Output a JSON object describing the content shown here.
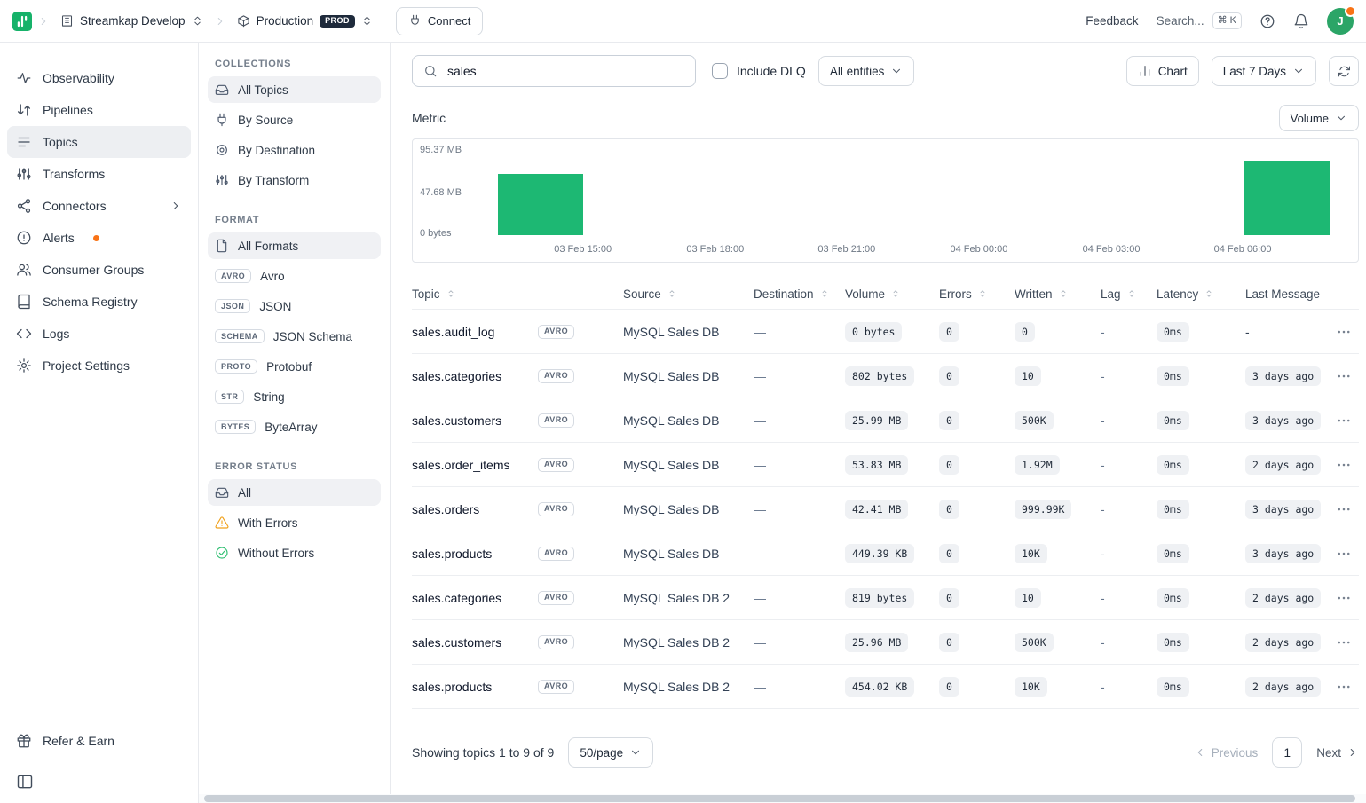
{
  "topbar": {
    "org": {
      "label": "Streamkap Develop"
    },
    "env": {
      "label": "Production",
      "badge": "PROD"
    },
    "connect_label": "Connect",
    "feedback_label": "Feedback",
    "search_label": "Search...",
    "search_shortcut": "⌘ K",
    "avatar_initial": "J"
  },
  "sidebar": {
    "items": [
      {
        "label": "Observability",
        "icon": "activity-icon"
      },
      {
        "label": "Pipelines",
        "icon": "pipelines-icon"
      },
      {
        "label": "Topics",
        "icon": "topics-icon",
        "active": true
      },
      {
        "label": "Transforms",
        "icon": "transforms-icon"
      },
      {
        "label": "Connectors",
        "icon": "connectors-icon",
        "chevron": true
      },
      {
        "label": "Alerts",
        "icon": "alert-icon",
        "dot": true
      },
      {
        "label": "Consumer Groups",
        "icon": "users-icon"
      },
      {
        "label": "Schema Registry",
        "icon": "schema-icon"
      },
      {
        "label": "Logs",
        "icon": "logs-icon"
      },
      {
        "label": "Project Settings",
        "icon": "gear-icon"
      }
    ],
    "refer_label": "Refer & Earn"
  },
  "filters": {
    "collections_title": "COLLECTIONS",
    "collections": [
      {
        "label": "All Topics",
        "icon": "inbox-icon",
        "active": true
      },
      {
        "label": "By Source",
        "icon": "source-icon"
      },
      {
        "label": "By Destination",
        "icon": "destination-icon"
      },
      {
        "label": "By Transform",
        "icon": "transforms-icon"
      }
    ],
    "format_title": "FORMAT",
    "formats": [
      {
        "label": "All Formats",
        "icon": "file-icon",
        "active": true
      },
      {
        "label": "Avro",
        "badge": "AVRO"
      },
      {
        "label": "JSON",
        "badge": "JSON"
      },
      {
        "label": "JSON Schema",
        "badge": "SCHEMA"
      },
      {
        "label": "Protobuf",
        "badge": "PROTO"
      },
      {
        "label": "String",
        "badge": "STR"
      },
      {
        "label": "ByteArray",
        "badge": "BYTES"
      }
    ],
    "error_title": "ERROR STATUS",
    "error_status": [
      {
        "label": "All",
        "icon": "inbox-icon",
        "active": true
      },
      {
        "label": "With Errors",
        "icon": "warning-icon"
      },
      {
        "label": "Without Errors",
        "icon": "check-icon"
      }
    ]
  },
  "toolbar": {
    "search_value": "sales",
    "include_dlq_label": "Include DLQ",
    "entities_label": "All entities",
    "chart_label": "Chart",
    "range_label": "Last 7 Days"
  },
  "metric": {
    "label": "Metric",
    "value": "Volume"
  },
  "chart_data": {
    "type": "bar",
    "metric": "Volume",
    "y_ticks": [
      "95.37 MB",
      "47.68 MB",
      "0 bytes"
    ],
    "y_max_mb": 95.37,
    "x_ticks": [
      {
        "label": "03 Feb 15:00",
        "frac": 0.18
      },
      {
        "label": "03 Feb 18:00",
        "frac": 0.32
      },
      {
        "label": "03 Feb 21:00",
        "frac": 0.459
      },
      {
        "label": "04 Feb 00:00",
        "frac": 0.599
      },
      {
        "label": "04 Feb 03:00",
        "frac": 0.739
      },
      {
        "label": "04 Feb 06:00",
        "frac": 0.878
      }
    ],
    "bars": [
      {
        "x_label": "03 Feb ~13:30",
        "value_mb": 68.5,
        "left_frac": 0.09,
        "width_frac": 0.09
      },
      {
        "x_label": "04 Feb ~06:30",
        "value_mb": 83.0,
        "left_frac": 0.88,
        "width_frac": 0.09
      }
    ],
    "bar_color": "#1db873",
    "grid": false,
    "legend": false
  },
  "table": {
    "columns": [
      {
        "label": "Topic",
        "sort": true
      },
      {
        "label": "Source",
        "sort": true
      },
      {
        "label": "Destination",
        "sort": true
      },
      {
        "label": "Volume",
        "sort": true
      },
      {
        "label": "Errors",
        "sort": true
      },
      {
        "label": "Written",
        "sort": true
      },
      {
        "label": "Lag",
        "sort": true
      },
      {
        "label": "Latency",
        "sort": true
      },
      {
        "label": "Last Message",
        "sort": false
      },
      {
        "label": "",
        "sort": false
      }
    ],
    "rows": [
      {
        "topic": "sales.audit_log",
        "format": "AVRO",
        "source": "MySQL Sales DB",
        "destination": "—",
        "volume": "0 bytes",
        "errors": "0",
        "written": "0",
        "lag": "-",
        "latency": "0ms",
        "last_message": "-"
      },
      {
        "topic": "sales.categories",
        "format": "AVRO",
        "source": "MySQL Sales DB",
        "destination": "—",
        "volume": "802 bytes",
        "errors": "0",
        "written": "10",
        "lag": "-",
        "latency": "0ms",
        "last_message": "3 days ago"
      },
      {
        "topic": "sales.customers",
        "format": "AVRO",
        "source": "MySQL Sales DB",
        "destination": "—",
        "volume": "25.99 MB",
        "errors": "0",
        "written": "500K",
        "lag": "-",
        "latency": "0ms",
        "last_message": "3 days ago"
      },
      {
        "topic": "sales.order_items",
        "format": "AVRO",
        "source": "MySQL Sales DB",
        "destination": "—",
        "volume": "53.83 MB",
        "errors": "0",
        "written": "1.92M",
        "lag": "-",
        "latency": "0ms",
        "last_message": "2 days ago"
      },
      {
        "topic": "sales.orders",
        "format": "AVRO",
        "source": "MySQL Sales DB",
        "destination": "—",
        "volume": "42.41 MB",
        "errors": "0",
        "written": "999.99K",
        "lag": "-",
        "latency": "0ms",
        "last_message": "3 days ago"
      },
      {
        "topic": "sales.products",
        "format": "AVRO",
        "source": "MySQL Sales DB",
        "destination": "—",
        "volume": "449.39 KB",
        "errors": "0",
        "written": "10K",
        "lag": "-",
        "latency": "0ms",
        "last_message": "3 days ago"
      },
      {
        "topic": "sales.categories",
        "format": "AVRO",
        "source": "MySQL Sales DB 2",
        "destination": "—",
        "volume": "819 bytes",
        "errors": "0",
        "written": "10",
        "lag": "-",
        "latency": "0ms",
        "last_message": "2 days ago"
      },
      {
        "topic": "sales.customers",
        "format": "AVRO",
        "source": "MySQL Sales DB 2",
        "destination": "—",
        "volume": "25.96 MB",
        "errors": "0",
        "written": "500K",
        "lag": "-",
        "latency": "0ms",
        "last_message": "2 days ago"
      },
      {
        "topic": "sales.products",
        "format": "AVRO",
        "source": "MySQL Sales DB 2",
        "destination": "—",
        "volume": "454.02 KB",
        "errors": "0",
        "written": "10K",
        "lag": "-",
        "latency": "0ms",
        "last_message": "2 days ago"
      }
    ]
  },
  "footer": {
    "summary": "Showing topics 1 to 9 of 9",
    "page_size": "50/page",
    "previous_label": "Previous",
    "page": "1",
    "next_label": "Next"
  }
}
